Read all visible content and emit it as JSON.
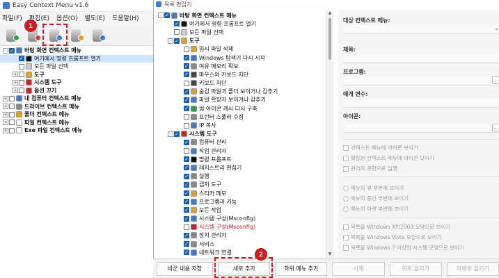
{
  "main_window": {
    "title": "Easy Context Menu v1.6",
    "menus": [
      "파일(F)",
      "편집(E)",
      "옵션(O)",
      "별도(E)",
      "도움말(H)"
    ],
    "toolbar": [
      {
        "name": "add-button",
        "badge_color": "#2ea043"
      },
      {
        "name": "remove-button",
        "badge_color": "#d73a49"
      },
      {
        "name": "list-editor-button",
        "badge_color": "#3a7bd5"
      },
      {
        "name": "cleaner-button",
        "badge_color": "#e3a21a"
      },
      {
        "name": "info-button",
        "badge_color": "#3a7bd5"
      }
    ],
    "tree": [
      {
        "label": "바탕 화면 컨텍스트 메뉴",
        "level": 0,
        "exp": "-",
        "checked": true,
        "bold": true,
        "icon": "#3a7bd5"
      },
      {
        "label": "여기에서 명령 프롬프트 열기",
        "level": 1,
        "exp": "",
        "checked": true,
        "bold": false,
        "icon": "#111111",
        "selected": true
      },
      {
        "label": "모든 파일 선택",
        "level": 1,
        "exp": "",
        "checked": false,
        "bold": false,
        "icon": "#cccccc"
      },
      {
        "label": "도구",
        "level": 1,
        "exp": "+",
        "checked": false,
        "bold": true,
        "icon": "#e3a21a"
      },
      {
        "label": "시스템 도구",
        "level": 1,
        "exp": "+",
        "checked": false,
        "bold": true,
        "icon": "#cc2222"
      },
      {
        "label": "옵션 끄기",
        "level": 1,
        "exp": "+",
        "checked": false,
        "bold": true,
        "icon": "#cc2222"
      },
      {
        "label": "내 컴퓨터 컨텍스트 메뉴",
        "level": 0,
        "exp": "+",
        "checked": false,
        "bold": true,
        "icon": "#3a7bd5"
      },
      {
        "label": "드라이브 컨텍스트 메뉴",
        "level": 0,
        "exp": "+",
        "checked": false,
        "bold": true,
        "icon": "#888888"
      },
      {
        "label": "폴더 컨텍스트 메뉴",
        "level": 0,
        "exp": "+",
        "checked": false,
        "bold": true,
        "icon": "#e3a21a"
      },
      {
        "label": "파일 컨텍스트 메뉴",
        "level": 0,
        "exp": "+",
        "checked": false,
        "bold": true,
        "icon": "#ffffff"
      },
      {
        "label": "Exe 파일 컨텍스트 메뉴",
        "level": 0,
        "exp": "+",
        "checked": false,
        "bold": true,
        "icon": "#ffffff"
      }
    ]
  },
  "editor_window": {
    "title": "목록 편집기",
    "tree": [
      {
        "label": "바탕 화면 컨텍스트 메뉴",
        "level": 0,
        "exp": "-",
        "checked": true,
        "bold": true,
        "icon": "#3a7bd5"
      },
      {
        "label": "여기에서 명령 프롬프트 열기",
        "level": 1,
        "exp": "",
        "checked": true,
        "bold": false,
        "icon": "#111111"
      },
      {
        "label": "모든 파일 선택",
        "level": 1,
        "exp": "",
        "checked": false,
        "bold": false,
        "icon": "#cccccc"
      },
      {
        "label": "도구",
        "level": 1,
        "exp": "-",
        "checked": true,
        "bold": true,
        "icon": "#e3a21a"
      },
      {
        "label": "임시 파일 삭제",
        "level": 2,
        "exp": "",
        "checked": false,
        "bold": false,
        "icon": "#e3a21a"
      },
      {
        "label": "Windows 탐색기 다시 시작",
        "level": 2,
        "exp": "",
        "checked": true,
        "bold": false,
        "icon": "#3a7bd5"
      },
      {
        "label": "여유 메모리 확보",
        "level": 2,
        "exp": "",
        "checked": true,
        "bold": false,
        "icon": "#888888"
      },
      {
        "label": "마우스와 키보드 차단",
        "level": 2,
        "exp": "",
        "checked": true,
        "bold": false,
        "icon": "#444444"
      },
      {
        "label": "키보드 차단",
        "level": 2,
        "exp": "",
        "checked": false,
        "bold": false,
        "icon": "#444444"
      },
      {
        "label": "숨김 파일과 폴더 보이거나 감추기",
        "level": 2,
        "exp": "",
        "checked": true,
        "bold": false,
        "icon": "#e3a21a"
      },
      {
        "label": "파일 확장자 보이거나 감추기",
        "level": 2,
        "exp": "",
        "checked": true,
        "bold": false,
        "icon": "#3a7bd5"
      },
      {
        "label": "썸 아이콘 캐시 다시 구축",
        "level": 2,
        "exp": "",
        "checked": true,
        "bold": false,
        "icon": "#2ea043"
      },
      {
        "label": "프린터 스풀러 수정",
        "level": 2,
        "exp": "",
        "checked": false,
        "bold": false,
        "icon": "#888888"
      },
      {
        "label": "IP 복사",
        "level": 2,
        "exp": "",
        "checked": false,
        "bold": false,
        "icon": "#3a7bd5"
      },
      {
        "label": "시스템 도구",
        "level": 1,
        "exp": "-",
        "checked": true,
        "bold": true,
        "icon": "#cc2222"
      },
      {
        "label": "컴퓨터 관리",
        "level": 2,
        "exp": "",
        "checked": true,
        "bold": false,
        "icon": "#888888"
      },
      {
        "label": "작업 관리자",
        "level": 2,
        "exp": "",
        "checked": false,
        "bold": false,
        "icon": "#3a7bd5"
      },
      {
        "label": "명령 프롬프트",
        "level": 2,
        "exp": "",
        "checked": true,
        "bold": false,
        "icon": "#111111"
      },
      {
        "label": "레지스트리 편집기",
        "level": 2,
        "exp": "",
        "checked": true,
        "bold": false,
        "icon": "#3a7bd5"
      },
      {
        "label": "실행",
        "level": 2,
        "exp": "",
        "checked": true,
        "bold": false,
        "icon": "#888888"
      },
      {
        "label": "캡처 도구",
        "level": 2,
        "exp": "",
        "checked": true,
        "bold": false,
        "icon": "#888888"
      },
      {
        "label": "스티커 메모",
        "level": 2,
        "exp": "",
        "checked": true,
        "bold": false,
        "icon": "#e3a21a"
      },
      {
        "label": "프로그램과 기능",
        "level": 2,
        "exp": "",
        "checked": true,
        "bold": false,
        "icon": "#3a7bd5"
      },
      {
        "label": "모든 작업",
        "level": 2,
        "exp": "",
        "checked": true,
        "bold": false,
        "icon": "#e3a21a"
      },
      {
        "label": "시스템 구성(Msconfig)",
        "level": 2,
        "exp": "",
        "checked": true,
        "bold": false,
        "icon": "#3a7bd5"
      },
      {
        "label": "시스템 구성(Msconfig)",
        "level": 2,
        "exp": "",
        "checked": false,
        "bold": false,
        "icon": "#cc2222",
        "red": true
      },
      {
        "label": "장치 관리자",
        "level": 2,
        "exp": "",
        "checked": true,
        "bold": false,
        "icon": "#888888"
      },
      {
        "label": "서비스",
        "level": 2,
        "exp": "",
        "checked": true,
        "bold": false,
        "icon": "#888888"
      },
      {
        "label": "네트워크 연결",
        "level": 2,
        "exp": "",
        "checked": true,
        "bold": false,
        "icon": "#3a7bd5"
      }
    ],
    "props": {
      "target_menu_label": "대상 컨텍스트 메뉴:",
      "title_label": "제목:",
      "program_label": "프로그램:",
      "param_label": "매개 변수:",
      "icon_label": "아이콘:",
      "browse": "...",
      "checks": [
        "컨텍스트 메뉴에 아이콘 보이기",
        "확장된 컨텍스트 메뉴에 아이콘 보이기",
        "관리자 권한으로 실행"
      ],
      "radios": [
        "메뉴의 윗 부분에 보이기",
        "메뉴의 중간 부분에 보이기",
        "메뉴의 아랫 부분에 보이기"
      ],
      "styles": [
        "목록을 Windows XP/2003 모양으로 보이기",
        "목록을 Windows Vista 모양으로 보이기",
        "목록을 Windows 7 이상의 시스템 모양으로 보이기"
      ]
    },
    "buttons": {
      "save": "바꾼 내용 저장",
      "add": "새로 추가",
      "add_sub": "하위 메뉴 추가",
      "delete": "삭제",
      "move_up": "위로 올리기",
      "move_down": "아래로 옮기기"
    }
  },
  "annotations": {
    "step1": "1",
    "step2": "2"
  }
}
